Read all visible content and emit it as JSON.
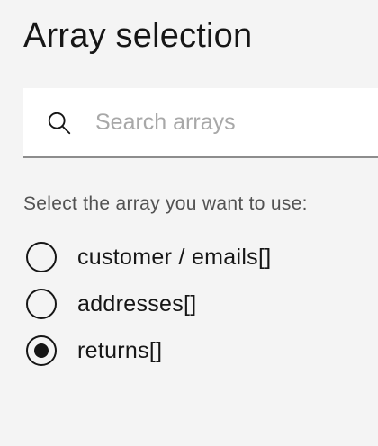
{
  "panel": {
    "title": "Array selection"
  },
  "search": {
    "placeholder": "Search arrays",
    "value": "",
    "icon": "search-icon"
  },
  "selection": {
    "prompt": "Select the array you want to use:",
    "options": [
      {
        "label": "customer / emails[]",
        "checked": false
      },
      {
        "label": "addresses[]",
        "checked": false
      },
      {
        "label": "returns[]",
        "checked": true
      }
    ]
  }
}
